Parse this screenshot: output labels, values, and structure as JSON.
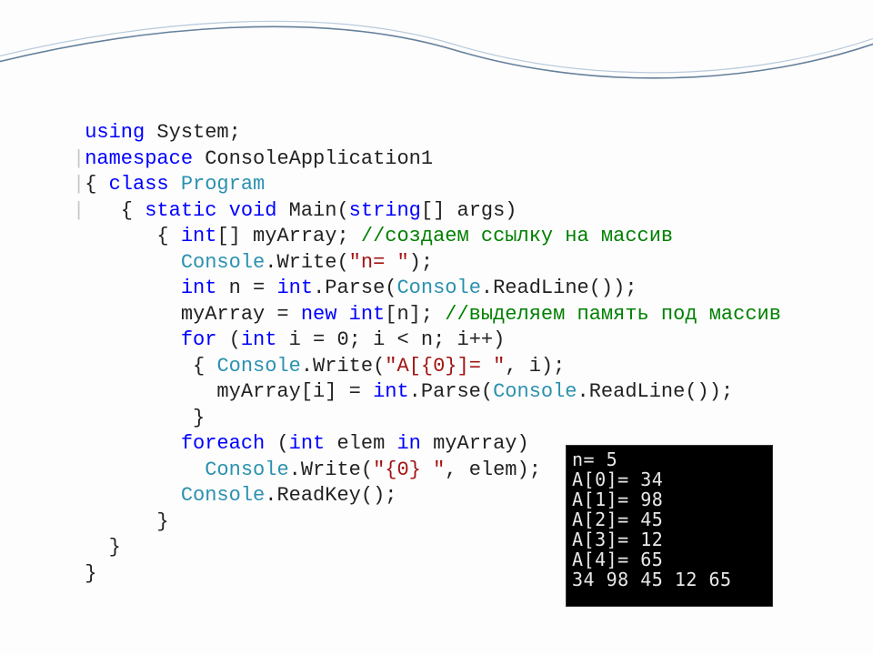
{
  "code": {
    "l1": {
      "kw1": "using",
      "nm": " System;"
    },
    "l2": {
      "bar": "|",
      "kw": "namespace",
      "nm": " ConsoleApplication1"
    },
    "l3": {
      "bar": "|",
      "br": "{ ",
      "kw": "class",
      "ty": " Program"
    },
    "l4": {
      "bar": "|",
      "pre": "   { ",
      "kw1": "static",
      "kw2": " void",
      "nm": " Main(",
      "kw3": "string",
      "nm2": "[] args)"
    },
    "l5": {
      "pre": "       { ",
      "kw": "int",
      "nm": "[] myArray; ",
      "cm": "//создаем ссылку на массив"
    },
    "l6": {
      "pre": "         ",
      "ty": "Console",
      "nm": ".Write(",
      "str": "\"n= \"",
      "nm2": ");"
    },
    "l7": {
      "pre": "         ",
      "kw": "int",
      "nm": " n = ",
      "kw2": "int",
      "nm2": ".Parse(",
      "ty": "Console",
      "nm3": ".ReadLine());"
    },
    "l8": {
      "pre": "         myArray = ",
      "kw": "new",
      "nm": " ",
      "kw2": "int",
      "nm2": "[n]; ",
      "cm": "//выделяем память под массив"
    },
    "l9": {
      "pre": "         ",
      "kw": "for",
      "nm": " (",
      "kw2": "int",
      "nm2": " i = 0; i < n; i++)"
    },
    "l10": {
      "pre": "          { ",
      "ty": "Console",
      "nm": ".Write(",
      "str": "\"A[{0}]= \"",
      "nm2": ", i);"
    },
    "l11": {
      "pre": "            myArray[i] = ",
      "kw": "int",
      "nm": ".Parse(",
      "ty": "Console",
      "nm2": ".ReadLine());"
    },
    "l12": {
      "pre": "          }"
    },
    "l13": {
      "pre": "         ",
      "kw": "foreach",
      "nm": " (",
      "kw2": "int",
      "nm2": " elem ",
      "kw3": "in",
      "nm3": " myArray)"
    },
    "l14": {
      "pre": "           ",
      "ty": "Console",
      "nm": ".Write(",
      "str": "\"{0} \"",
      "nm2": ", elem);"
    },
    "l15": {
      "pre": "         ",
      "ty": "Console",
      "nm": ".ReadKey();"
    },
    "l16": {
      "pre": "       }"
    },
    "l17": {
      "pre": "   }"
    },
    "l18": {
      "pre": " }"
    }
  },
  "console_output": "n= 5\nA[0]= 34\nA[1]= 98\nA[2]= 45\nA[3]= 12\nA[4]= 65\n34 98 45 12 65"
}
